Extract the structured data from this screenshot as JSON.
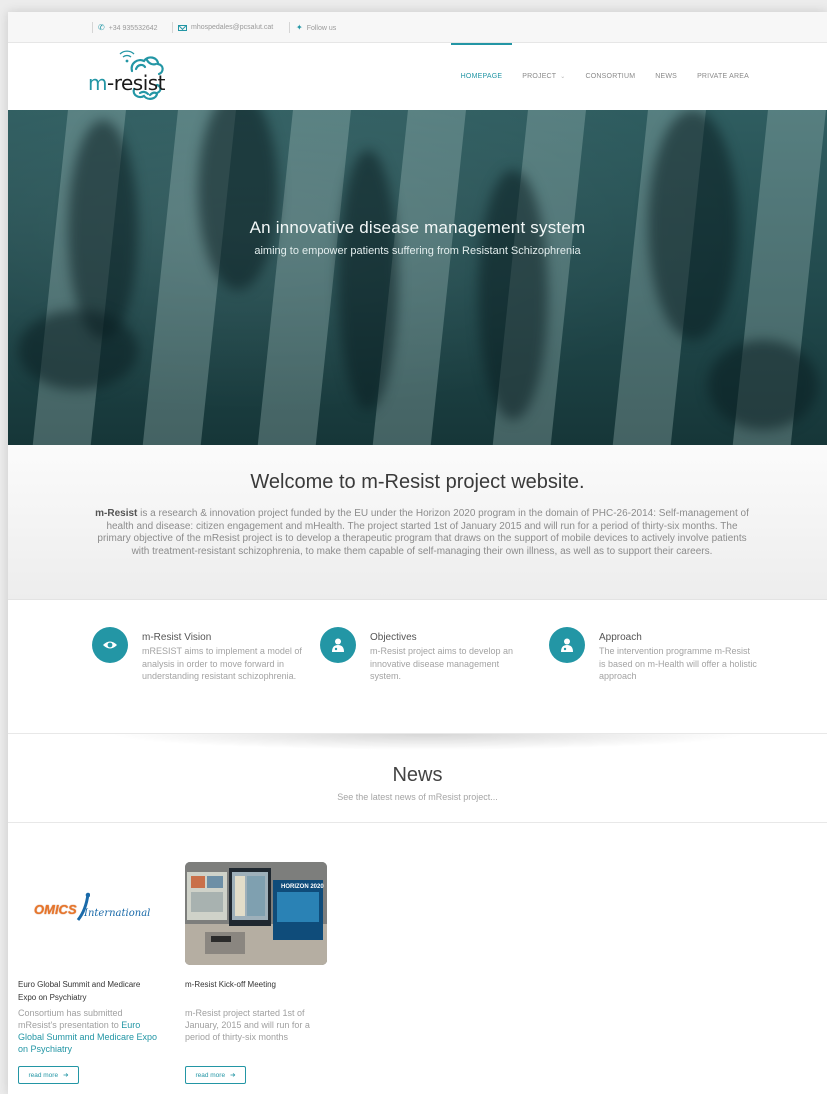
{
  "topbar": {
    "phone": "+34 935532642",
    "email": "mhospedales@pcsalut.cat",
    "follow": "Follow us"
  },
  "logo": {
    "text_m": "m",
    "text_rest": "-resist"
  },
  "nav": {
    "items": [
      {
        "label": "HOMEPAGE",
        "active": true
      },
      {
        "label": "PROJECT",
        "has_dropdown": true
      },
      {
        "label": "CONSORTIUM"
      },
      {
        "label": "NEWS"
      },
      {
        "label": "PRIVATE AREA"
      }
    ]
  },
  "hero": {
    "title": "An innovative disease management system",
    "subtitle": "aiming to empower patients suffering from Resistant Schizophrenia"
  },
  "welcome": {
    "heading": "Welcome to m-Resist project website.",
    "brand": "m-Resist",
    "body": " is a research & innovation project funded by the EU under the Horizon 2020 program in the domain of PHC-26-2014: Self-management of health and disease: citizen engagement and mHealth. The project started 1st of January 2015 and will run for a period of thirty-six months.  The primary objective of the mResist project is to develop a therapeutic program that draws on the support of mobile devices to actively involve patients with treatment-resistant schizophrenia, to make them capable of self-managing their own illness, as well as to support their careers."
  },
  "features": [
    {
      "icon": "eye-icon",
      "title": "m-Resist Vision",
      "desc": "mRESIST aims to implement a model of analysis in order to move forward in understanding resistant schizophrenia."
    },
    {
      "icon": "doctor-icon",
      "title": "Objectives",
      "desc": "m-Resist project aims to develop an innovative disease management system."
    },
    {
      "icon": "doctor-icon",
      "title": "Approach",
      "desc": "The intervention programme m-Resist is based on m-Health will offer a holistic approach"
    }
  ],
  "news": {
    "heading": "News",
    "subheading": "See the latest news of mResist project...",
    "items": [
      {
        "title": "Euro Global Summit and Medicare Expo on Psychiatry",
        "desc_prefix": "Consortium has submitted mResist's presentation to ",
        "desc_link": "Euro Global Summit and Medicare Expo on Psychiatry",
        "button": "read more",
        "logo_text_1": "OMICS",
        "logo_text_2": "International"
      },
      {
        "title": "m-Resist Kick-off Meeting",
        "desc_prefix": "m-Resist project started 1st of January, 2015 and will run for a period of thirty-six months",
        "desc_link": "",
        "button": "read more",
        "photo_text": "HORIZON 2020"
      }
    ]
  },
  "colors": {
    "accent": "#2396a5",
    "text": "#555555"
  }
}
